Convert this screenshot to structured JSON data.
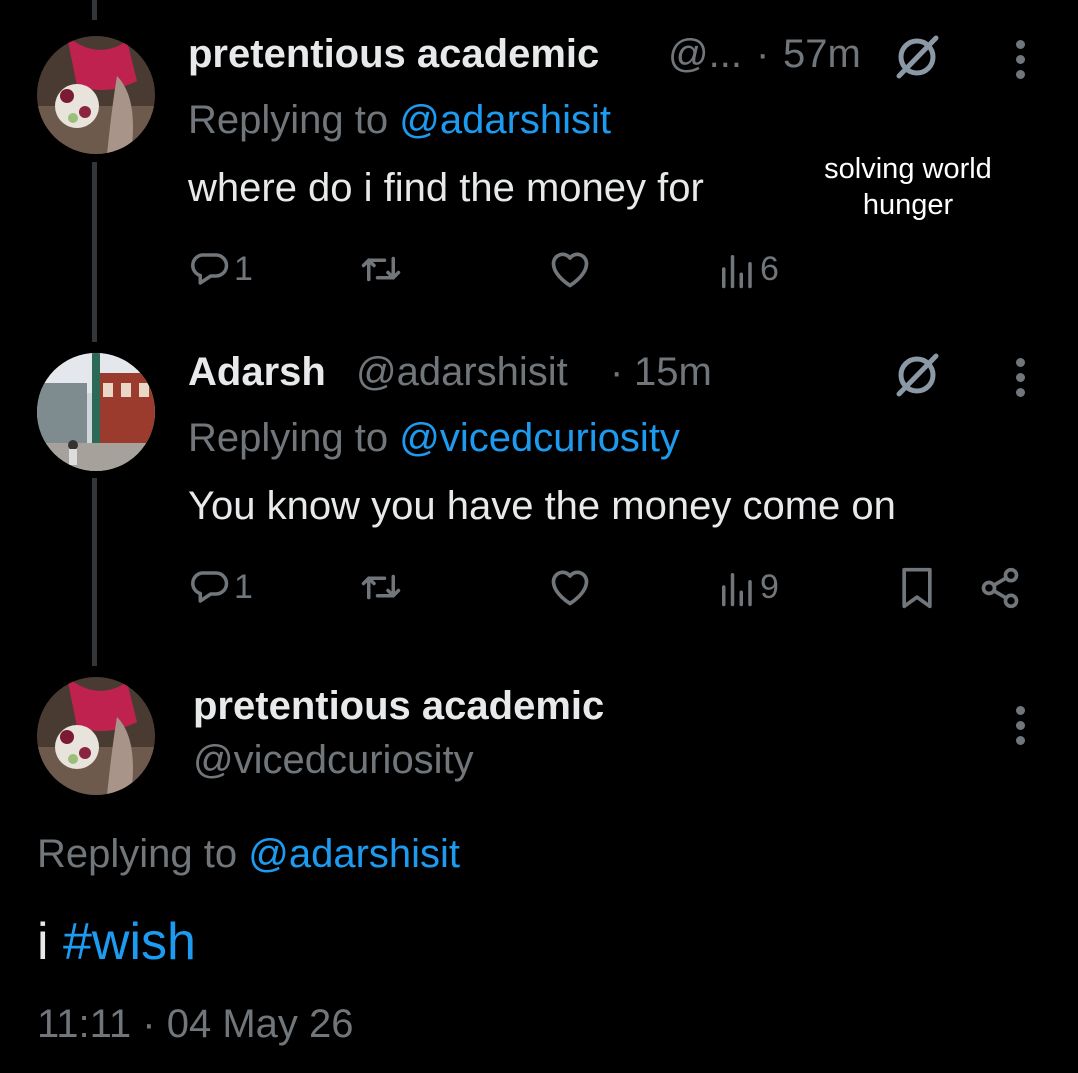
{
  "tweets": [
    {
      "name": "pretentious academic",
      "handle_truncated": "@...",
      "dot": "·",
      "time": "57m",
      "replying_prefix": "Replying to",
      "replying_handle": "@adarshisit",
      "text": "where do i find the money for",
      "overlay_text_line1": "solving world",
      "overlay_text_line2": "hunger",
      "replies": "1",
      "views": "6"
    },
    {
      "name": "Adarsh",
      "handle": "@adarshisit",
      "dot": "·",
      "time": "15m",
      "replying_prefix": "Replying to",
      "replying_handle": "@vicedcuriosity",
      "text": "You know you have the money come on",
      "replies": "1",
      "views": "9"
    }
  ],
  "main_tweet": {
    "name": "pretentious academic",
    "handle": "@vicedcuriosity",
    "replying_prefix": "Replying to",
    "replying_handle": "@adarshisit",
    "text_prefix": "i",
    "hashtag": "#wish",
    "timestamp": "11:11 · 04 May 26"
  },
  "icons": {
    "reply": "reply-icon",
    "retweet": "retweet-icon",
    "like": "heart-icon",
    "views": "views-icon",
    "bookmark": "bookmark-icon",
    "share": "share-icon",
    "hide": "hidden-reply-icon",
    "more": "more-vertical-icon"
  },
  "colors": {
    "background": "#000000",
    "text": "#e7e9ea",
    "muted": "#71767b",
    "link": "#1d9bf0"
  }
}
